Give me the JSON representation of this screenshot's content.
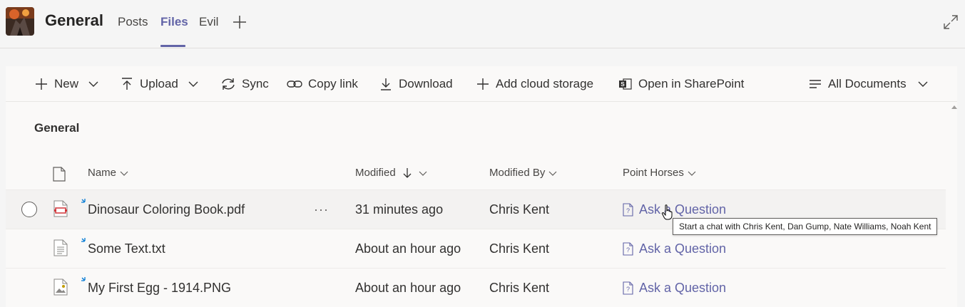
{
  "header": {
    "channel_name": "General",
    "tabs": [
      {
        "label": "Posts",
        "active": false
      },
      {
        "label": "Files",
        "active": true
      },
      {
        "label": "Evil",
        "active": false
      }
    ],
    "accent_color": "#6264a7"
  },
  "toolbar": {
    "new_label": "New",
    "upload_label": "Upload",
    "sync_label": "Sync",
    "copy_link_label": "Copy link",
    "download_label": "Download",
    "add_cloud_storage_label": "Add cloud storage",
    "open_sharepoint_label": "Open in SharePoint",
    "view_label": "All Documents"
  },
  "library": {
    "title": "General",
    "columns": {
      "name": "Name",
      "modified": "Modified",
      "modified_by": "Modified By",
      "point_horses": "Point Horses"
    },
    "rows": [
      {
        "name": "Dinosaur Coloring Book.pdf",
        "modified": "31 minutes ago",
        "modified_by": "Chris Kent",
        "action": "Ask a Question",
        "icon": "pdf-file-icon"
      },
      {
        "name": "Some Text.txt",
        "modified": "About an hour ago",
        "modified_by": "Chris Kent",
        "action": "Ask a Question",
        "icon": "text-file-icon"
      },
      {
        "name": "My First Egg - 1914.PNG",
        "modified": "About an hour ago",
        "modified_by": "Chris Kent",
        "action": "Ask a Question",
        "icon": "image-file-icon"
      }
    ]
  },
  "tooltip": {
    "text": "Start a chat with Chris Kent, Dan Gump, Nate Williams, Noah Kent"
  }
}
